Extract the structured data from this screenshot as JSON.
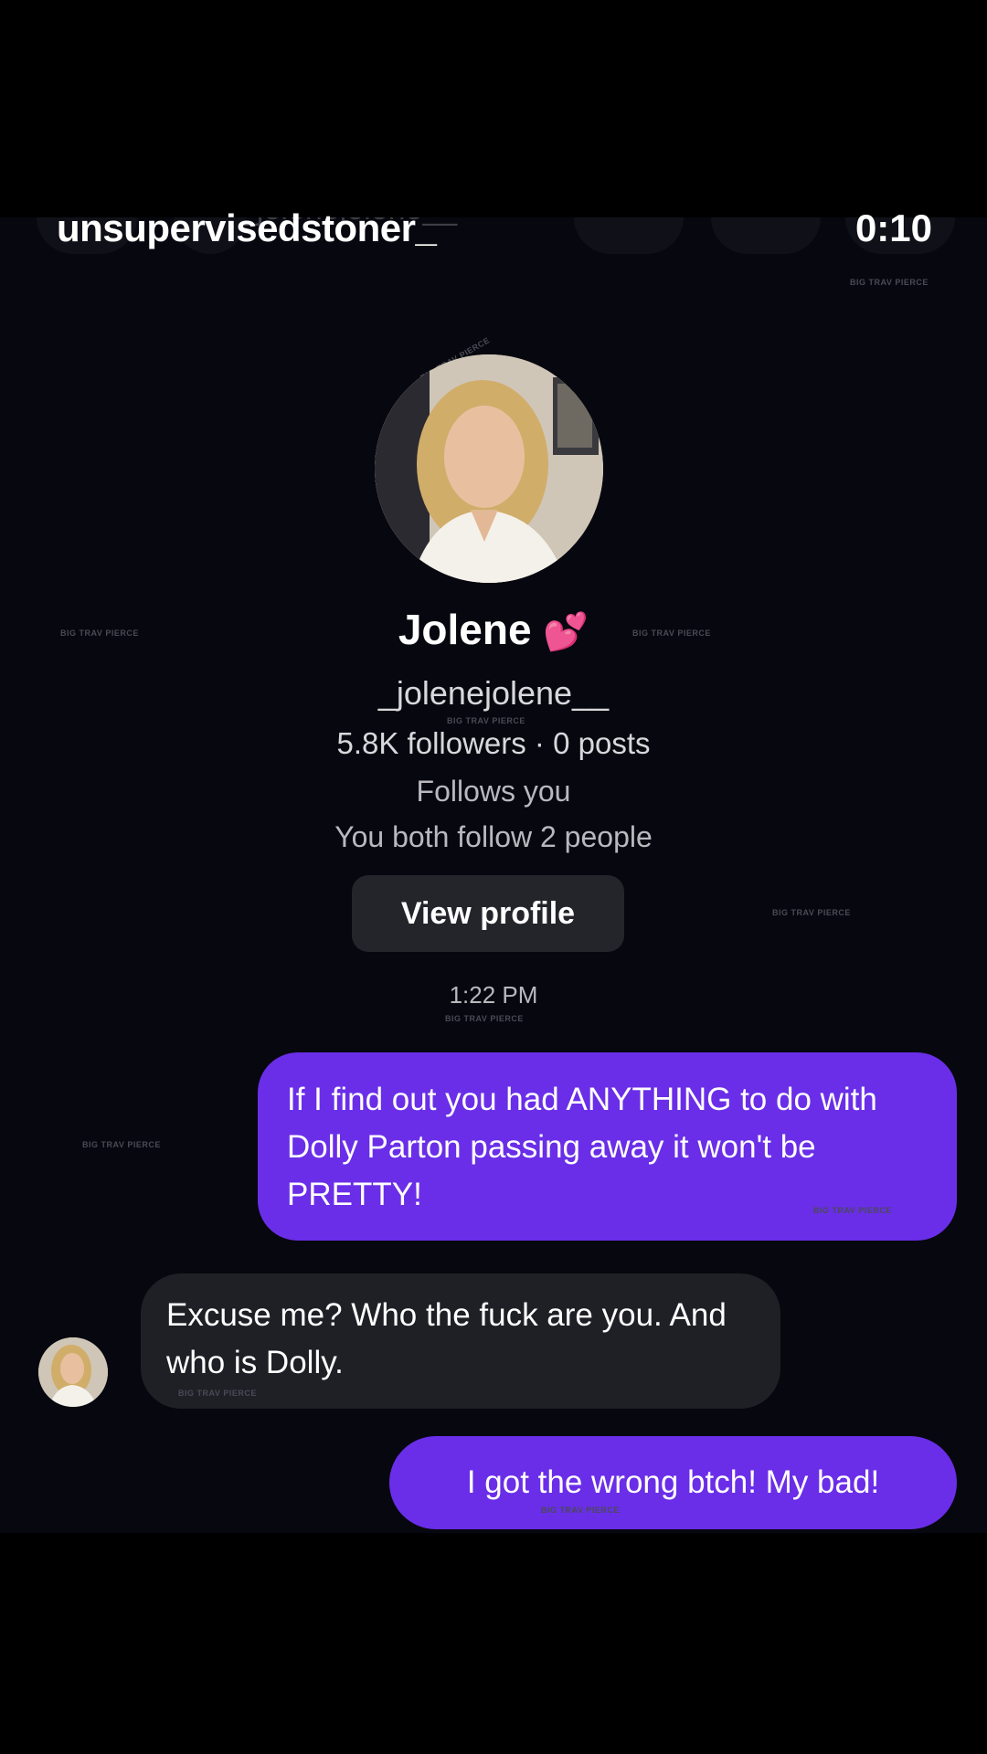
{
  "story": {
    "username": "unsupervisedstoner_",
    "timer": "0:10"
  },
  "chat": {
    "header_ghost_handle": "_jolenejolene__",
    "profile": {
      "name": "Jolene",
      "emoji": "💕",
      "handle": "_jolenejolene__",
      "stats": "5.8K followers · 0 posts",
      "follows_you": "Follows you",
      "mutual": "You both follow 2 people",
      "view_profile_label": "View profile"
    },
    "timestamp": "1:22 PM",
    "messages": [
      {
        "from": "me",
        "text": "If I find out you had ANYTHING to do with Dolly Parton passing away it won't be PRETTY!"
      },
      {
        "from": "them",
        "text": "Excuse me? Who the fuck are you. And who is Dolly."
      },
      {
        "from": "me",
        "text": "I got the wrong btch! My bad!"
      }
    ],
    "watermark": "BIG TRAV PIERCE"
  },
  "colors": {
    "outgoing_bubble": "#6a2ee8",
    "incoming_bubble": "#1f1f26",
    "background": "#07070f"
  }
}
